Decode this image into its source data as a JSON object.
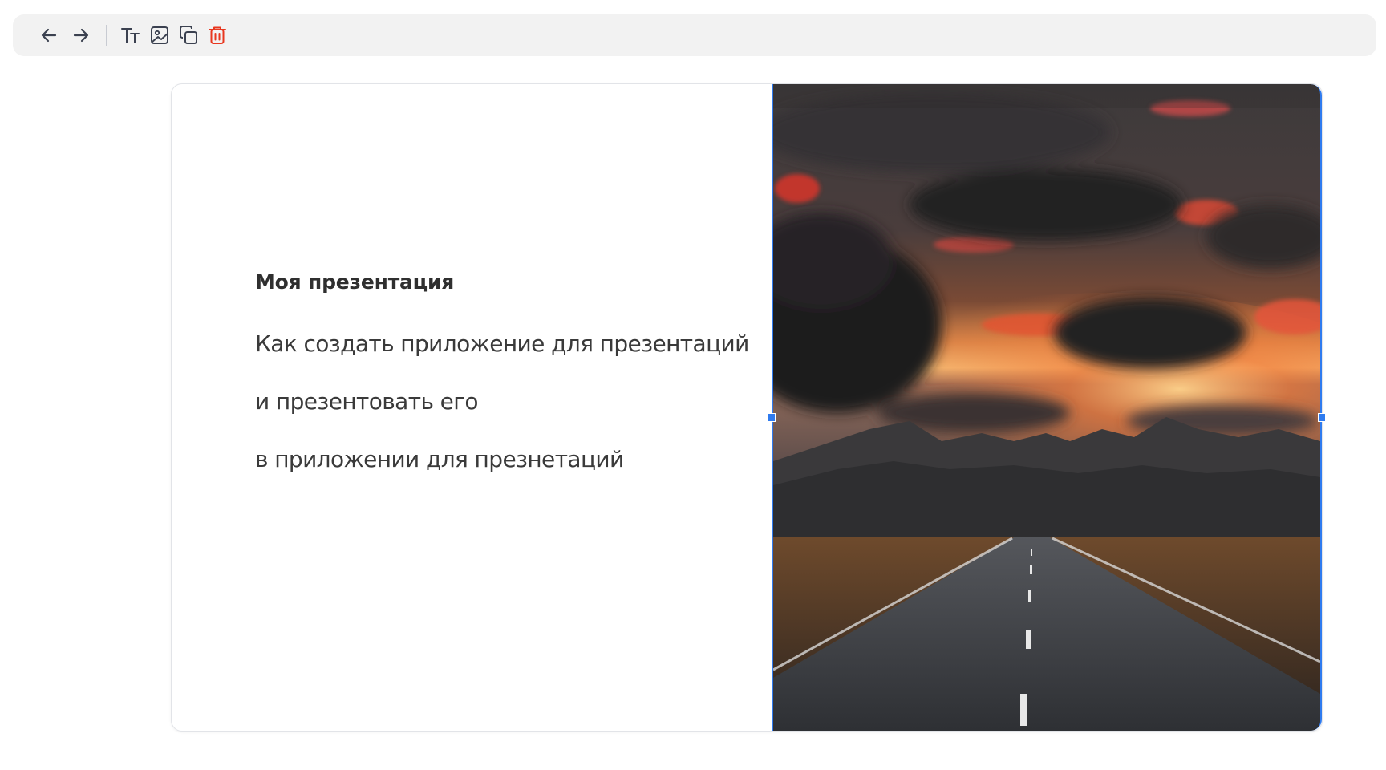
{
  "toolbar": {
    "buttons": [
      {
        "name": "undo",
        "icon": "arrow-left-icon"
      },
      {
        "name": "redo",
        "icon": "arrow-right-icon"
      },
      {
        "name": "text",
        "icon": "text-size-icon"
      },
      {
        "name": "image",
        "icon": "image-icon"
      },
      {
        "name": "duplicate",
        "icon": "copy-icon"
      },
      {
        "name": "delete",
        "icon": "trash-icon"
      }
    ],
    "icon_color": "#3b4150",
    "delete_color": "#e8371f"
  },
  "slide": {
    "title": "Моя презентация",
    "lines": [
      "Как создать приложение для презентаций",
      "и презентовать его",
      "в приложении для презнетаций"
    ],
    "image": {
      "selected": true,
      "selection_color": "#2f7bef"
    }
  }
}
